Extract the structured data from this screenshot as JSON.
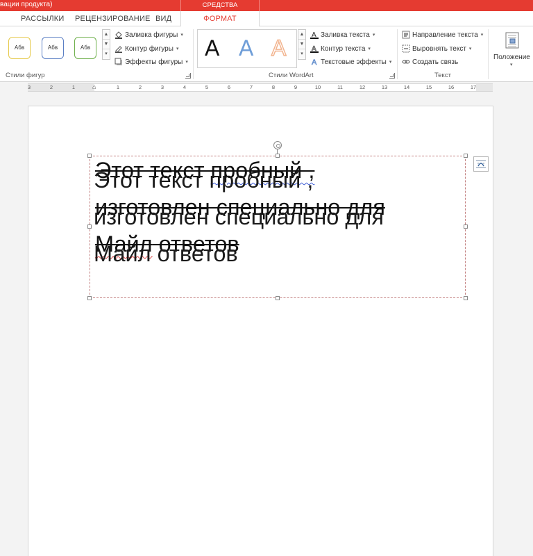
{
  "titlebar": {
    "title_fragment": "вации продукта)",
    "context_group": "СРЕДСТВА РИСОВАНИЯ"
  },
  "tabs": [
    {
      "label": "РАССЫЛКИ"
    },
    {
      "label": "РЕЦЕНЗИРОВАНИЕ"
    },
    {
      "label": "ВИД"
    },
    {
      "label": "ФОРМАТ",
      "active": true
    }
  ],
  "ribbon": {
    "shape_styles": {
      "label": "Стили фигур",
      "thumbs": [
        {
          "text": "Абв",
          "border": "#e6c94a"
        },
        {
          "text": "Абв",
          "border": "#5b7fc4"
        },
        {
          "text": "Абв",
          "border": "#6fb04c"
        }
      ],
      "commands": [
        "Заливка фигуры",
        "Контур фигуры",
        "Эффекты фигуры"
      ]
    },
    "wordart": {
      "label": "Стили WordArt",
      "samples": [
        {
          "char": "A",
          "color": "#111111"
        },
        {
          "char": "A",
          "color": "#6f9ed8"
        },
        {
          "char": "A",
          "color": "#f2b48f"
        }
      ],
      "commands": [
        "Заливка текста",
        "Контур текста",
        "Текстовые эффекты"
      ]
    },
    "text_group": {
      "label": "Текст",
      "commands": [
        "Направление текста",
        "Выровнять текст",
        "Создать связь"
      ]
    },
    "arrange": {
      "position_label": "Положение"
    }
  },
  "ruler": {
    "numbers": [
      "3",
      "2",
      "1",
      "1",
      "2",
      "3",
      "4",
      "5",
      "6",
      "7",
      "8",
      "9",
      "10",
      "11",
      "12",
      "13",
      "14",
      "15",
      "16",
      "17"
    ]
  },
  "document": {
    "lines": [
      {
        "parts": [
          {
            "t": "Этот текст ",
            "s": ""
          },
          {
            "t": "пробный ,",
            "s": "grammar"
          }
        ]
      },
      {
        "parts": [
          {
            "t": "изготовлен специально для",
            "s": ""
          }
        ]
      },
      {
        "parts": [
          {
            "t": "Майл",
            "s": "spell"
          },
          {
            "t": " ответов",
            "s": ""
          }
        ]
      }
    ]
  }
}
